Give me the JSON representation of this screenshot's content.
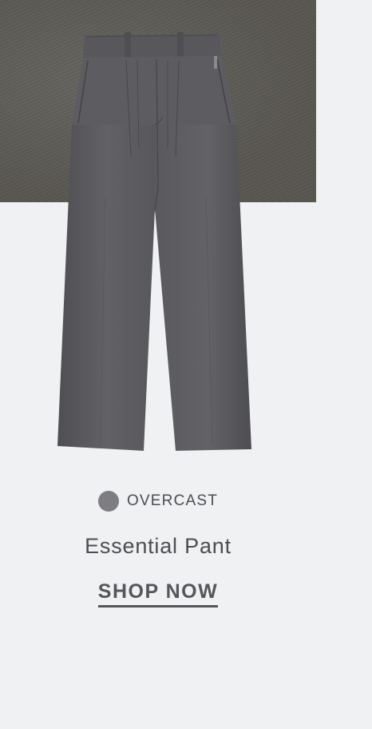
{
  "product": {
    "color_label": "OVERCAST",
    "color_hex": "#7d7d82",
    "name": "Essential Pant",
    "cta_label": "SHOP NOW",
    "image_icon": "trousers-image",
    "fabric_swatch_color": "#5c5a57"
  }
}
